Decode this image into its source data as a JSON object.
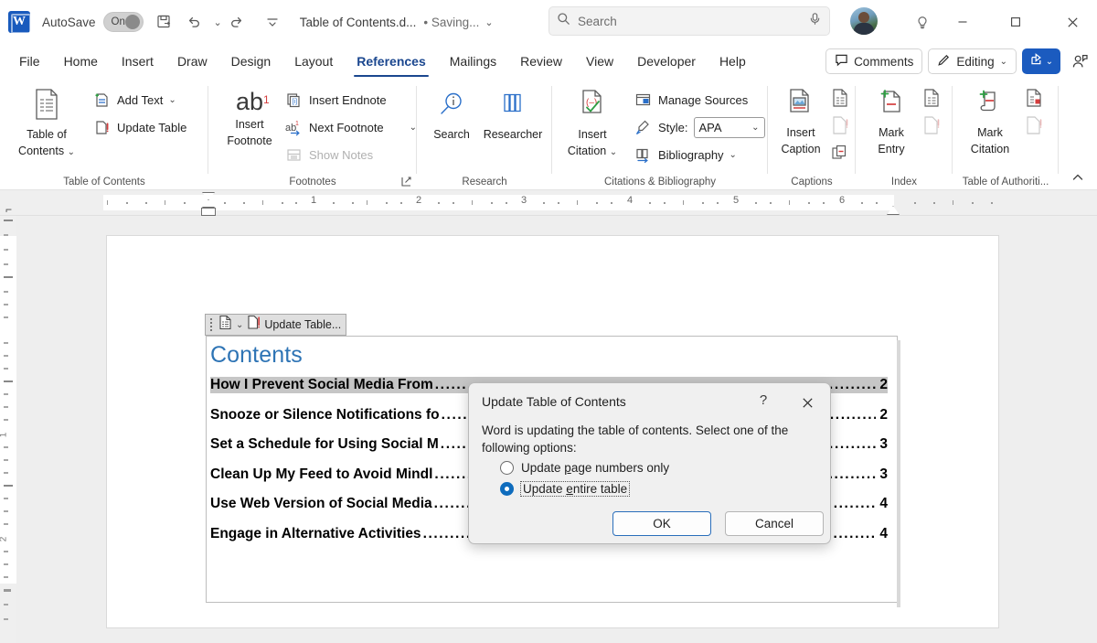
{
  "titlebar": {
    "app_icon": "word-logo",
    "autosave_label": "AutoSave",
    "autosave_state": "On",
    "save_icon": "save-sync-icon",
    "undo_icon": "undo-icon",
    "redo_icon": "redo-icon",
    "customize_icon": "customize-quick-access-icon",
    "doc_title": "Table of Contents.d...",
    "save_status": "• Saving...",
    "title_caret": "chevron-down-icon",
    "minimize": "—",
    "maximize": "□",
    "close": "✕"
  },
  "search": {
    "placeholder": "Search",
    "icon": "search-icon",
    "mic_icon": "microphone-icon"
  },
  "account": {
    "avatar": "user-avatar",
    "lightbulb_icon": "tell-me-lightbulb-icon"
  },
  "tabs": [
    {
      "label": "File",
      "active": false
    },
    {
      "label": "Home",
      "active": false
    },
    {
      "label": "Insert",
      "active": false
    },
    {
      "label": "Draw",
      "active": false
    },
    {
      "label": "Design",
      "active": false
    },
    {
      "label": "Layout",
      "active": false
    },
    {
      "label": "References",
      "active": true
    },
    {
      "label": "Mailings",
      "active": false
    },
    {
      "label": "Review",
      "active": false
    },
    {
      "label": "View",
      "active": false
    },
    {
      "label": "Developer",
      "active": false
    },
    {
      "label": "Help",
      "active": false
    }
  ],
  "tab_right": {
    "comments_label": "Comments",
    "comments_icon": "comment-icon",
    "editing_label": "Editing",
    "editing_icon": "pencil-icon",
    "editing_caret": "chevron-down-icon",
    "share_icon": "share-icon",
    "share_caret": "chevron-down-icon",
    "person_add_icon": "person-add-icon"
  },
  "ribbon": {
    "collapse_icon": "chevron-up-icon",
    "groups": [
      {
        "name": "Table of Contents",
        "label": "Table of Contents",
        "big_button": {
          "label_line1": "Table of",
          "label_line2": "Contents",
          "icon": "table-of-contents-icon",
          "caret": "chevron-down-icon"
        },
        "items": [
          {
            "label": "Add Text",
            "icon": "add-text-icon",
            "caret": "chevron-down-icon",
            "disabled": false
          },
          {
            "label": "Update Table",
            "icon": "update-table-icon",
            "caret": "",
            "disabled": false
          }
        ]
      },
      {
        "name": "Footnotes",
        "label": "Footnotes",
        "big_button": {
          "label_line1": "Insert",
          "label_line2": "Footnote",
          "icon": "insert-footnote-ab-icon",
          "caret": ""
        },
        "items": [
          {
            "label": "Insert Endnote",
            "icon": "insert-endnote-icon",
            "caret": "",
            "disabled": false
          },
          {
            "label": "Next Footnote",
            "icon": "next-footnote-icon",
            "caret": "chevron-down-icon",
            "disabled": false
          },
          {
            "label": "Show Notes",
            "icon": "show-notes-icon",
            "caret": "",
            "disabled": true
          }
        ],
        "dialog_launcher": "dialog-box-launcher-icon"
      },
      {
        "name": "Research",
        "label": "Research",
        "buttons": [
          {
            "label": "Search",
            "icon": "smart-lookup-icon"
          },
          {
            "label": "Researcher",
            "icon": "researcher-books-icon"
          }
        ]
      },
      {
        "name": "Citations & Bibliography",
        "label": "Citations & Bibliography",
        "big_button": {
          "label_line1": "Insert",
          "label_line2": "Citation",
          "icon": "insert-citation-icon",
          "caret": "chevron-down-icon"
        },
        "items": [
          {
            "label": "Manage Sources",
            "icon": "manage-sources-icon",
            "caret": "",
            "disabled": false
          },
          {
            "label": "Style:",
            "icon": "style-brush-icon",
            "caret": "",
            "disabled": false,
            "select_value": "APA",
            "select_caret": "chevron-down-icon"
          },
          {
            "label": "Bibliography",
            "icon": "bibliography-icon",
            "caret": "chevron-down-icon",
            "disabled": false
          }
        ]
      },
      {
        "name": "Captions",
        "label": "Captions",
        "big_button": {
          "label_line1": "Insert",
          "label_line2": "Caption",
          "icon": "insert-caption-icon",
          "caret": ""
        },
        "side_icons": [
          "insert-table-of-figures-icon",
          "update-table-icon",
          "cross-reference-icon"
        ]
      },
      {
        "name": "Index",
        "label": "Index",
        "big_button": {
          "label_line1": "Mark",
          "label_line2": "Entry",
          "icon": "mark-entry-icon",
          "caret": ""
        },
        "side_icons": [
          "insert-index-icon",
          "update-index-icon"
        ]
      },
      {
        "name": "Table of Authorities",
        "label": "Table of Authoriti...",
        "big_button": {
          "label_line1": "Mark",
          "label_line2": "Citation",
          "icon": "mark-citation-icon",
          "caret": ""
        },
        "side_icons": [
          "insert-table-of-authorities-icon",
          "update-table-icon"
        ]
      }
    ]
  },
  "ruler": {
    "h_numbers": [
      "1",
      "2",
      "3",
      "4",
      "5",
      "6"
    ],
    "v_numbers": [
      "1",
      "2"
    ],
    "left_indent_marker": "first-line-indent-marker",
    "right_indent_marker": "right-indent-marker",
    "tab_selector": "tab-stop-selector"
  },
  "toc_field": {
    "toolbar": {
      "grip_icon": "drag-grip-icon",
      "content_control_icon": "toc-content-control-icon",
      "dropdown_caret": "chevron-down-icon",
      "update_icon": "update-table-icon",
      "update_label": "Update Table..."
    },
    "heading": "Contents",
    "entries": [
      {
        "title": "How I Prevent Social Media From",
        "page": "2",
        "selected": true
      },
      {
        "title": "Snooze or Silence Notifications fo",
        "page": "2",
        "selected": false
      },
      {
        "title": "Set a Schedule for Using Social M",
        "page": "3",
        "selected": false
      },
      {
        "title": "Clean Up My Feed to Avoid Mindl",
        "page": "3",
        "selected": false
      },
      {
        "title": "Use Web Version of Social Media",
        "page": "4",
        "selected": false
      },
      {
        "title": "Engage in Alternative Activities",
        "page": "4",
        "selected": false
      }
    ]
  },
  "dialog": {
    "title": "Update Table of Contents",
    "help_icon": "?",
    "close_icon": "✕",
    "body_text": "Word is updating the table of contents.  Select one of the following options:",
    "options": [
      {
        "label_pre": "Update ",
        "label_underline": "p",
        "label_post": "age numbers only",
        "checked": false,
        "focused": false
      },
      {
        "label_pre": "Update ",
        "label_underline": "e",
        "label_post": "ntire table",
        "checked": true,
        "focused": true
      }
    ],
    "ok_label": "OK",
    "cancel_label": "Cancel"
  },
  "colors": {
    "accent_blue": "#1b5bbf",
    "tab_active": "#1b478f",
    "heading_blue": "#2E74B5",
    "radio_checked": "#0F6CBD",
    "selection_gray": "#c6c6c6"
  }
}
